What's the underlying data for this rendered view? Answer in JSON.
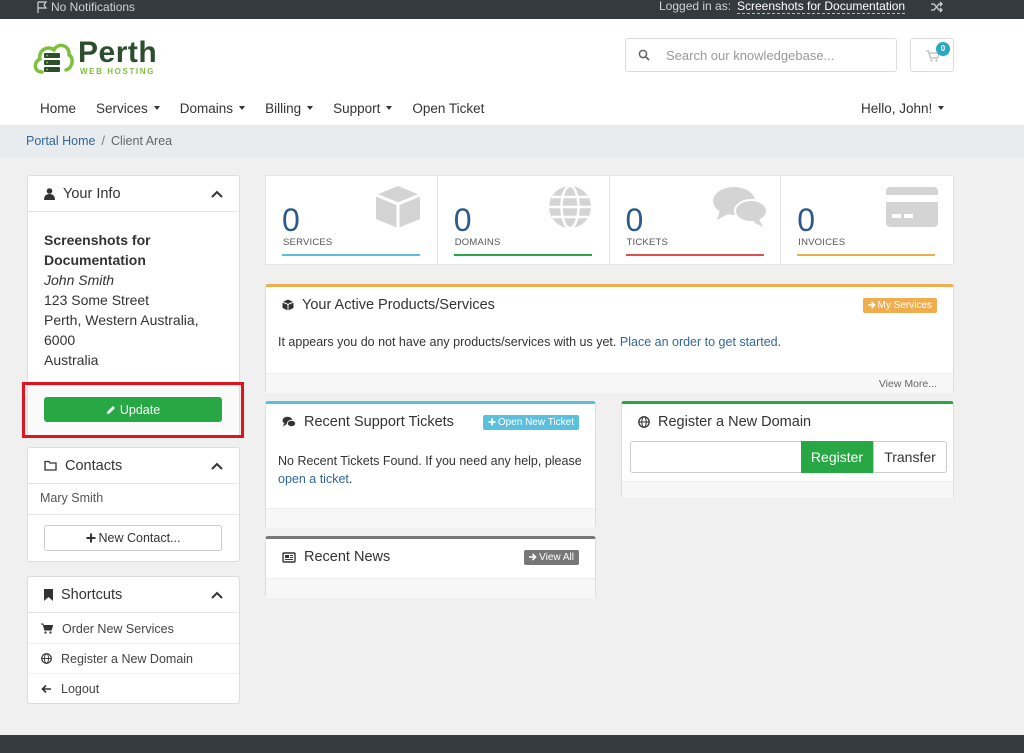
{
  "topbar": {
    "notifications": "No Notifications",
    "logged_in_label": "Logged in as:",
    "account_name": "Screenshots for Documentation"
  },
  "brand": {
    "name": "Perth",
    "tagline": "WEB HOSTING",
    "primary_color": "#28a745",
    "accent_color": "#336699"
  },
  "search": {
    "placeholder": "Search our knowledgebase..."
  },
  "cart": {
    "count": "0"
  },
  "nav": {
    "items": [
      {
        "label": "Home",
        "has_dropdown": false
      },
      {
        "label": "Services",
        "has_dropdown": true
      },
      {
        "label": "Domains",
        "has_dropdown": true
      },
      {
        "label": "Billing",
        "has_dropdown": true
      },
      {
        "label": "Support",
        "has_dropdown": true
      },
      {
        "label": "Open Ticket",
        "has_dropdown": false
      }
    ],
    "user_greeting": "Hello, John!"
  },
  "breadcrumb": {
    "home": "Portal Home",
    "separator": "/",
    "current": "Client Area"
  },
  "sidebar": {
    "your_info": {
      "title": "Your Info",
      "company": "Screenshots for Documentation",
      "name": "John Smith",
      "address1": "123 Some Street",
      "city_state": "Perth, Western Australia,",
      "postcode": "6000",
      "country": "Australia",
      "update_label": "Update"
    },
    "contacts": {
      "title": "Contacts",
      "items": [
        "Mary Smith"
      ],
      "new_contact_label": "New Contact..."
    },
    "shortcuts": {
      "title": "Shortcuts",
      "items": [
        {
          "label": "Order New Services",
          "icon": "cart-icon"
        },
        {
          "label": "Register a New Domain",
          "icon": "globe-icon"
        },
        {
          "label": "Logout",
          "icon": "arrow-left-icon"
        }
      ]
    }
  },
  "stats": [
    {
      "value": "0",
      "label": "SERVICES",
      "color": "#5bc0de",
      "icon": "cube-icon"
    },
    {
      "value": "0",
      "label": "DOMAINS",
      "color": "#28a745",
      "icon": "globe-icon"
    },
    {
      "value": "0",
      "label": "TICKETS",
      "color": "#d9534f",
      "icon": "comments-icon"
    },
    {
      "value": "0",
      "label": "INVOICES",
      "color": "#f0ad4e",
      "icon": "credit-card-icon"
    }
  ],
  "products": {
    "title": "Your Active Products/Services",
    "button": "My Services",
    "message": "It appears you do not have any products/services with us yet.",
    "link": "Place an order to get started",
    "link_suffix": ".",
    "view_more": "View More..."
  },
  "tickets": {
    "title": "Recent Support Tickets",
    "button": "Open New Ticket",
    "message": "No Recent Tickets Found. If you need any help, please",
    "link": "open a ticket",
    "link_suffix": "."
  },
  "domain": {
    "title": "Register a New Domain",
    "register_label": "Register",
    "transfer_label": "Transfer"
  },
  "news": {
    "title": "Recent News",
    "button": "View All"
  }
}
